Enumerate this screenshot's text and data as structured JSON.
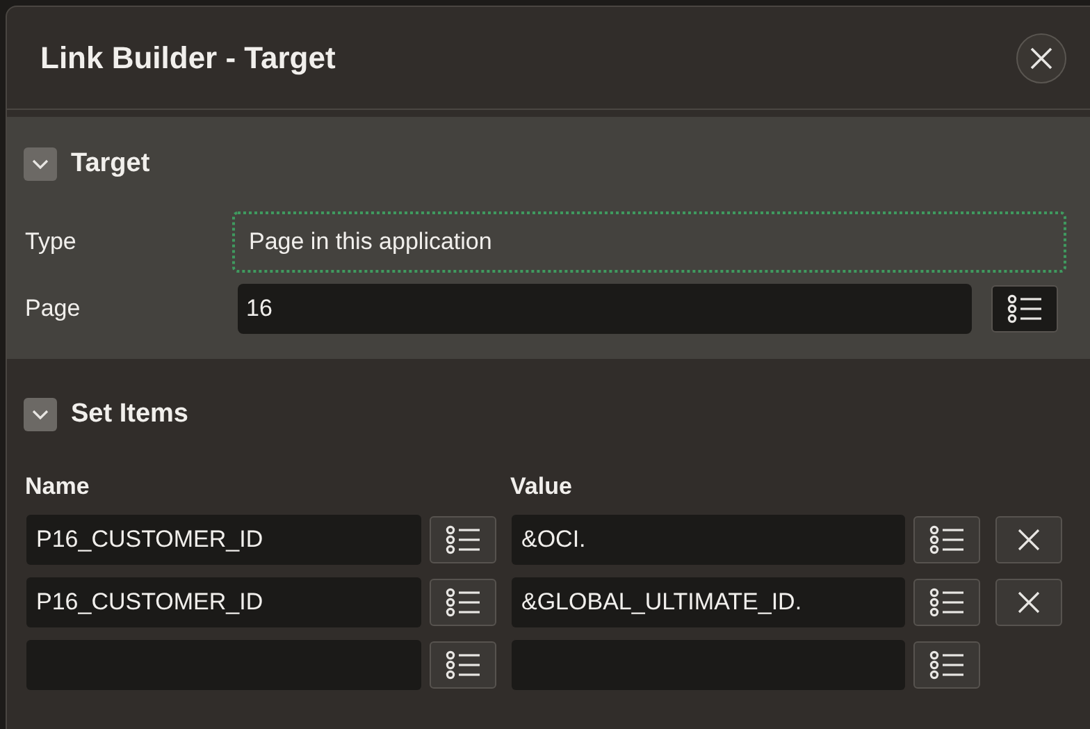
{
  "dialog": {
    "title": "Link Builder - Target"
  },
  "target": {
    "title": "Target",
    "expanded": true,
    "type": {
      "label": "Type",
      "value": "Page in this application",
      "focused": true
    },
    "page": {
      "label": "Page",
      "value": "16"
    }
  },
  "set_items": {
    "title": "Set Items",
    "expanded": true,
    "columns": [
      "Name",
      "Value"
    ],
    "rows": [
      {
        "name": "P16_CUSTOMER_ID",
        "value": "&OCI.",
        "removable": true
      },
      {
        "name": "P16_CUSTOMER_ID",
        "value": "&GLOBAL_ULTIMATE_ID.",
        "removable": true
      },
      {
        "name": "",
        "value": "",
        "removable": false
      }
    ]
  }
}
